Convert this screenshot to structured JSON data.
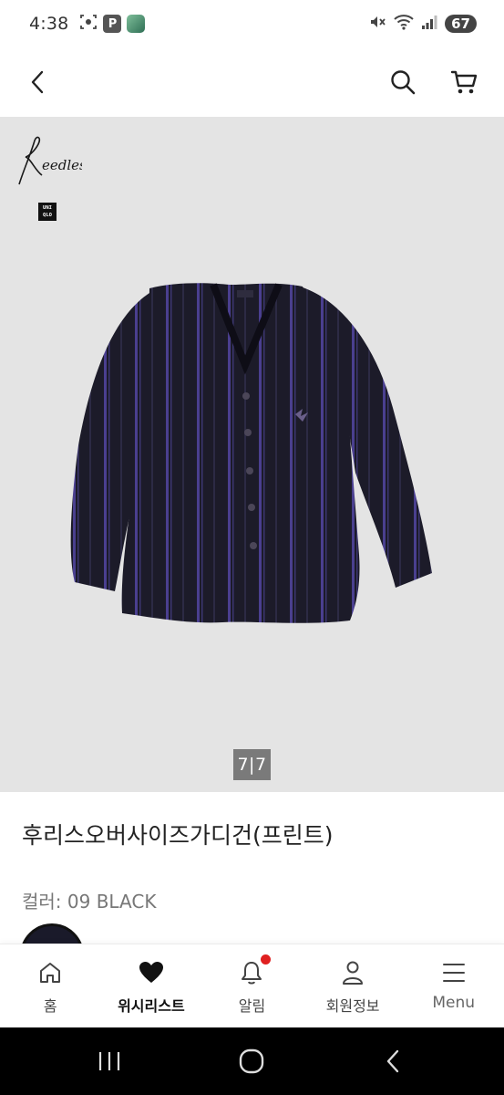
{
  "status_bar": {
    "time": "4:38",
    "p_icon_label": "P",
    "battery": "67"
  },
  "header": {
    "back_icon": "chevron-left-icon",
    "search_icon": "search-icon",
    "cart_icon": "cart-icon"
  },
  "product": {
    "brand_needles": "Needles",
    "brand_uniqlo": [
      "UNI",
      "QLO"
    ],
    "image_counter": "7|7",
    "title": "후리스오버사이즈가디건(프린트)",
    "color_label": "컬러: 09 BLACK",
    "colors": {
      "background": "#e4e4e4",
      "garment": "#1c1b29",
      "stripe": "#4a3f8f"
    }
  },
  "tab_bar": {
    "items": [
      {
        "label": "홈",
        "icon": "home-icon"
      },
      {
        "label": "위시리스트",
        "icon": "heart-icon",
        "active": true
      },
      {
        "label": "알림",
        "icon": "bell-icon",
        "badge": true
      },
      {
        "label": "회원정보",
        "icon": "user-icon"
      },
      {
        "label": "Menu",
        "icon": "menu-icon"
      }
    ],
    "badge_color": "#e02020"
  },
  "system_nav": {
    "recent_icon": "recent-apps-icon",
    "home_icon": "home-circle-icon",
    "back_icon": "back-arrow-icon"
  }
}
